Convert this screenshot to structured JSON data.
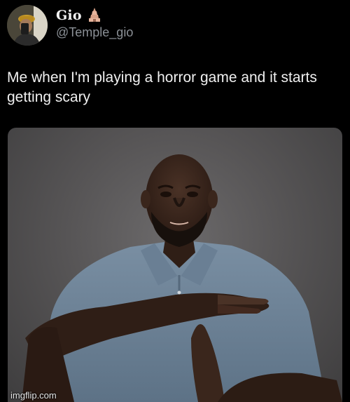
{
  "tweet": {
    "author": {
      "display_name": "Gio",
      "handle": "@Temple_gio",
      "name_emoji_icon": "temple-icon"
    },
    "text": "Me when I'm playing a horror game and it starts getting scary",
    "media": {
      "alt_subject": "man-making-timeout-gesture",
      "shirt_color": "#6d8296",
      "background_color": "#5a5859"
    }
  },
  "watermark": "imgflip.com"
}
